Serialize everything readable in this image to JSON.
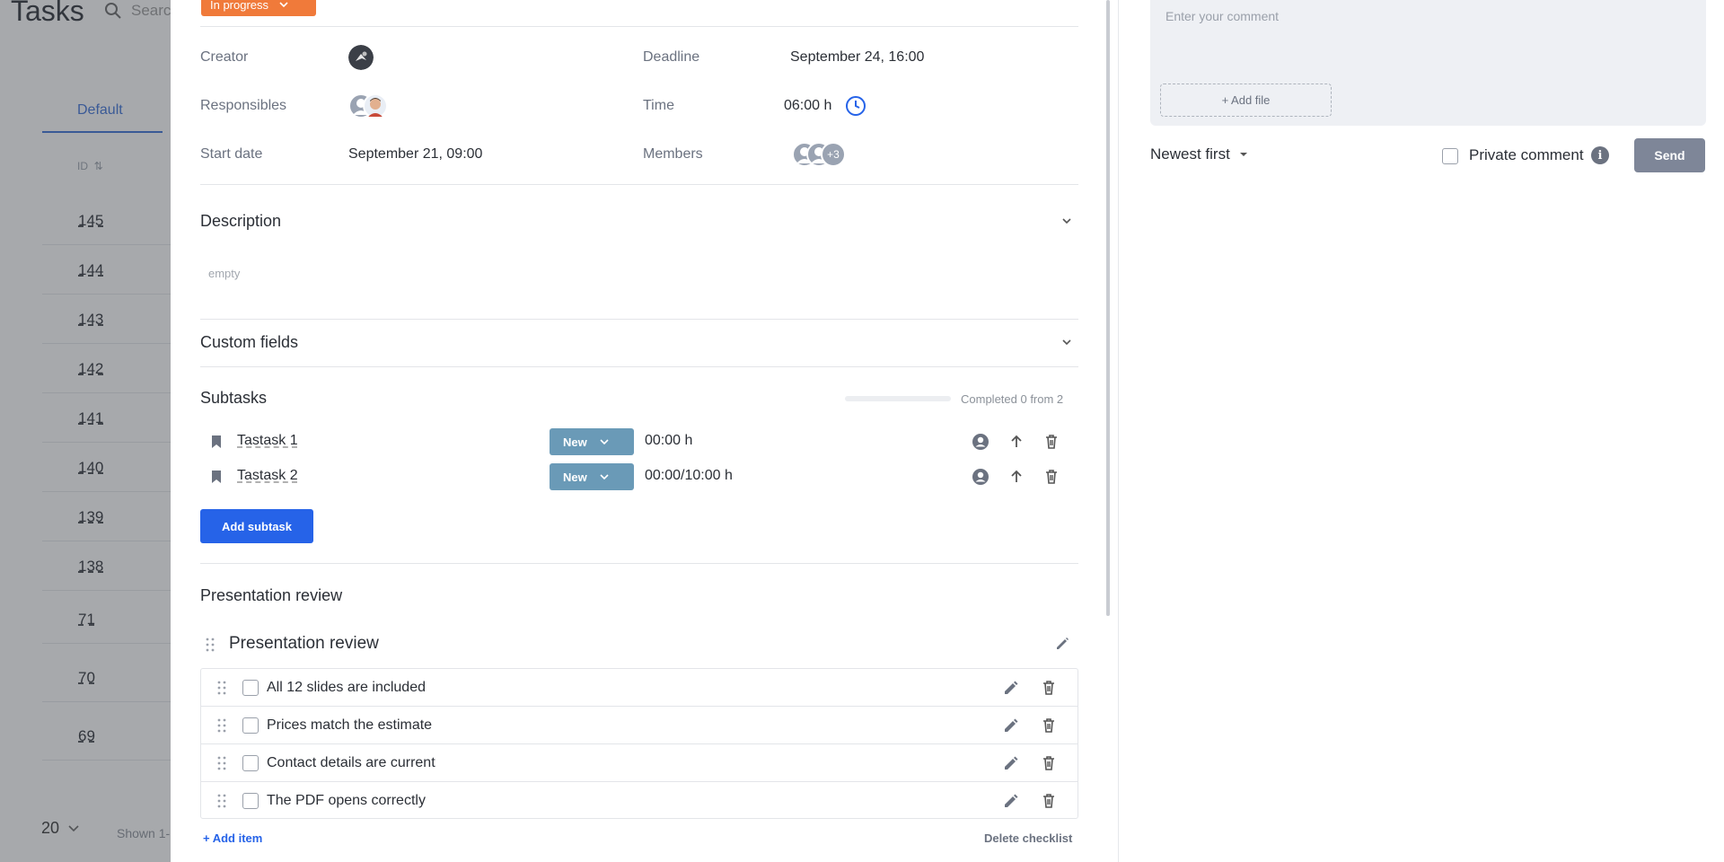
{
  "background": {
    "page_title": "Tasks",
    "search_placeholder": "Search",
    "tab_default": "Default",
    "id_header": "ID",
    "rows": [
      "145",
      "144",
      "143",
      "142",
      "141",
      "140",
      "139",
      "138",
      "71",
      "70",
      "69"
    ],
    "page_size": "20",
    "shown": "Shown 1-"
  },
  "task": {
    "status": "In progress",
    "creator_label": "Creator",
    "responsibles_label": "Responsibles",
    "start_date_label": "Start date",
    "start_date": "September 21, 09:00",
    "deadline_label": "Deadline",
    "deadline": "September 24, 16:00",
    "time_label": "Time",
    "time": "06:00 h",
    "members_label": "Members",
    "members_more": "+3"
  },
  "description": {
    "title": "Description",
    "text": "empty"
  },
  "custom_fields": {
    "title": "Custom fields"
  },
  "subtasks": {
    "title": "Subtasks",
    "completed": "Completed 0 from 2",
    "progress": 0,
    "items": [
      {
        "name": "Tastask 1",
        "status": "New",
        "time": "00:00 h"
      },
      {
        "name": "Tastask 2",
        "status": "New",
        "time": "00:00/10:00 h"
      }
    ],
    "add_label": "Add subtask"
  },
  "checklist": {
    "section_title": "Presentation review",
    "name": "Presentation review",
    "items": [
      {
        "text": "All 12 slides are included",
        "checked": false
      },
      {
        "text": "Prices match the estimate",
        "checked": false
      },
      {
        "text": "Contact details are current",
        "checked": false
      },
      {
        "text": "The PDF opens correctly",
        "checked": false
      }
    ],
    "add_item": "+ Add item",
    "delete": "Delete checklist"
  },
  "comments": {
    "placeholder": "Enter your comment",
    "add_file": "+ Add file",
    "sort": "Newest first",
    "private_label": "Private comment",
    "send": "Send"
  },
  "colors": {
    "status_in_progress": "#f07a3a",
    "status_new": "#6a9ab7",
    "primary": "#2663e8",
    "send_disabled": "#7e8698"
  }
}
